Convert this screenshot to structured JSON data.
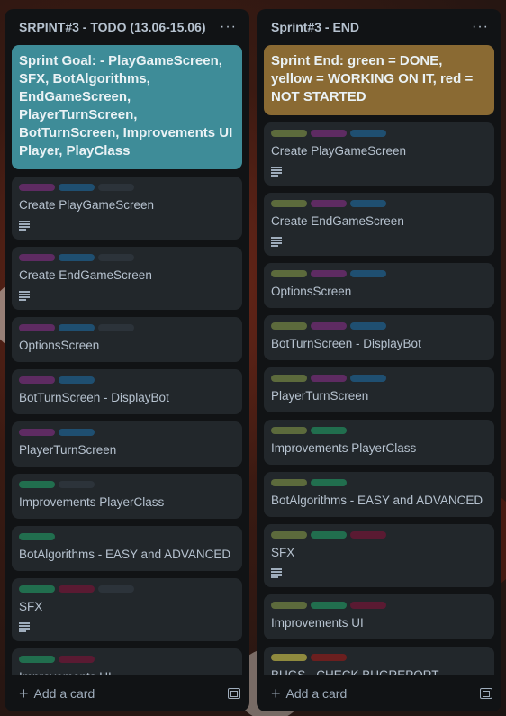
{
  "colors": {
    "label_green": "#4bce97",
    "label_green_dim": "#216e4e",
    "label_purple": "#5e2b62",
    "label_blue": "#1f4f71",
    "label_dark": "#2c333a",
    "label_olive": "#6f7c4a",
    "label_red": "#6e1a32",
    "label_yellow": "#a59a49",
    "label_brick": "#6f2a20",
    "cover_teal": "#3f8a98",
    "cover_gold": "#8a6730"
  },
  "lists": [
    {
      "title": "SRPINT#3 - TODO (13.06-15.06)",
      "menu": "···",
      "cards": [
        {
          "cover": true,
          "cover_color": "#3e8c98",
          "title": "Sprint Goal: - PlayGameScreen, SFX, BotAlgorithms, EndGameScreen, PlayerTurnScreen, BotTurnScreen, Improvements UI Player, PlayClass"
        },
        {
          "labels": [
            "#5e2b62",
            "#1f4f71",
            "#2c333a"
          ],
          "title": "Create PlayGameScreen",
          "desc": true
        },
        {
          "labels": [
            "#5e2b62",
            "#1f4f71",
            "#2c333a"
          ],
          "title": "Create EndGameScreen",
          "desc": true
        },
        {
          "labels": [
            "#5e2b62",
            "#1f4f71",
            "#2c333a"
          ],
          "title": "OptionsScreen",
          "desc": false
        },
        {
          "labels": [
            "#5e2b62",
            "#1f4f71"
          ],
          "title": "BotTurnScreen - DisplayBot",
          "desc": false
        },
        {
          "labels": [
            "#5e2b62",
            "#1f4f71"
          ],
          "title": "PlayerTurnScreen",
          "desc": false
        },
        {
          "labels": [
            "#216e4e",
            "#2c333a"
          ],
          "title": "Improvements PlayerClass",
          "desc": false
        },
        {
          "labels": [
            "#216e4e"
          ],
          "title": "BotAlgorithms - EASY and ADVANCED",
          "desc": false
        },
        {
          "labels": [
            "#216e4e",
            "#5a1a32",
            "#2c333a"
          ],
          "title": "SFX",
          "desc": true
        },
        {
          "labels": [
            "#216e4e",
            "#5a1a32"
          ],
          "title": "Improvements UI",
          "desc": false
        }
      ],
      "add_card": "Add a card"
    },
    {
      "title": "Sprint#3 - END",
      "menu": "···",
      "cards": [
        {
          "cover": true,
          "cover_color": "#8a6a33",
          "title": "Sprint End: green = DONE, yellow = WORKING ON IT, red = NOT STARTED"
        },
        {
          "labels": [
            "#5c6a3c",
            "#5e2b62",
            "#1f4f71"
          ],
          "title": "Create PlayGameScreen",
          "desc": true
        },
        {
          "labels": [
            "#5c6a3c",
            "#5e2b62",
            "#1f4f71"
          ],
          "title": "Create EndGameScreen",
          "desc": true
        },
        {
          "labels": [
            "#5c6a3c",
            "#5e2b62",
            "#1f4f71"
          ],
          "title": "OptionsScreen",
          "desc": false
        },
        {
          "labels": [
            "#5c6a3c",
            "#5e2b62",
            "#1f4f71"
          ],
          "title": "BotTurnScreen - DisplayBot",
          "desc": false
        },
        {
          "labels": [
            "#5c6a3c",
            "#5e2b62",
            "#1f4f71"
          ],
          "title": "PlayerTurnScreen",
          "desc": false
        },
        {
          "labels": [
            "#5c6a3c",
            "#216e4e"
          ],
          "title": "Improvements PlayerClass",
          "desc": false
        },
        {
          "labels": [
            "#5c6a3c",
            "#216e4e"
          ],
          "title": "BotAlgorithms - EASY and ADVANCED",
          "desc": false
        },
        {
          "labels": [
            "#5c6a3c",
            "#216e4e",
            "#5a1a32"
          ],
          "title": "SFX",
          "desc": true
        },
        {
          "labels": [
            "#5c6a3c",
            "#216e4e",
            "#5a1a32"
          ],
          "title": "Improvements UI",
          "desc": false
        },
        {
          "labels": [
            "#8f8a3e",
            "#6b1f1f"
          ],
          "title": "BUGS - CHECK BUGREPORT",
          "desc": false
        }
      ],
      "add_card": "Add a card"
    }
  ]
}
